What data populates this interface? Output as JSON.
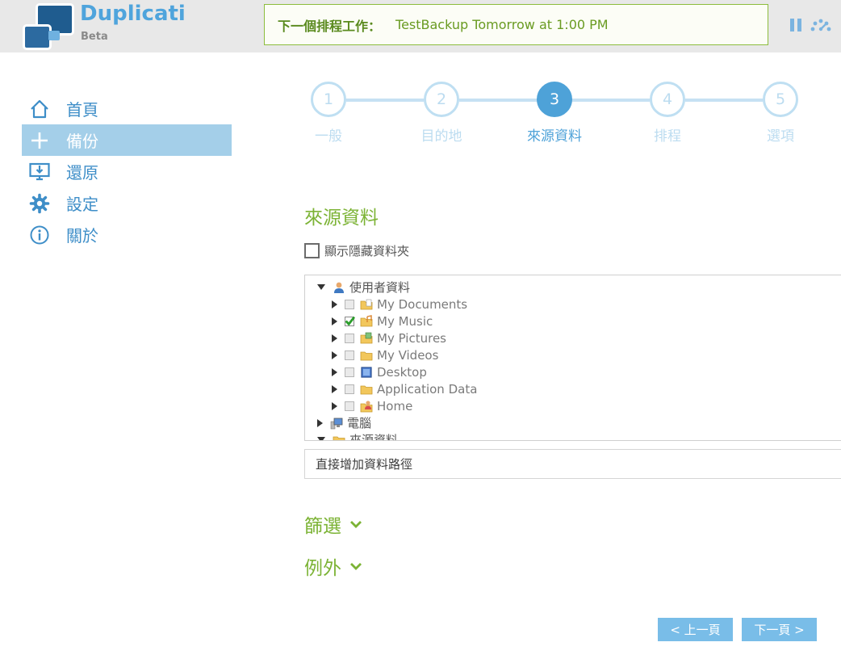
{
  "app": {
    "name": "Duplicati",
    "edition": "Beta"
  },
  "schedule": {
    "label": "下一個排程工作：",
    "value": "TestBackup Tomorrow at 1:00 PM"
  },
  "header_icons": [
    "pause-icon",
    "throttle-icon"
  ],
  "sidebar": {
    "items": [
      {
        "label": "首頁",
        "icon": "home-icon",
        "active": false
      },
      {
        "label": "備份",
        "icon": "plus-icon",
        "active": true
      },
      {
        "label": "還原",
        "icon": "restore-icon",
        "active": false
      },
      {
        "label": "設定",
        "icon": "gear-icon",
        "active": false
      },
      {
        "label": "關於",
        "icon": "info-icon",
        "active": false
      }
    ]
  },
  "stepper": {
    "current": 3,
    "steps": [
      {
        "number": "1",
        "label": "一般"
      },
      {
        "number": "2",
        "label": "目的地"
      },
      {
        "number": "3",
        "label": "來源資料"
      },
      {
        "number": "4",
        "label": "排程"
      },
      {
        "number": "5",
        "label": "選項"
      }
    ]
  },
  "source": {
    "title": "來源資料",
    "show_hidden_label": "顯示隱藏資料夾",
    "show_hidden_checked": false
  },
  "tree": {
    "nodes": [
      {
        "label": "使用者資料",
        "level": 0,
        "expanded": true,
        "checkbox": false,
        "icon": "user-icon"
      },
      {
        "label": "My Documents",
        "level": 1,
        "expanded": false,
        "checkbox": true,
        "checked": false,
        "icon": "documents-folder-icon"
      },
      {
        "label": "My Music",
        "level": 1,
        "expanded": false,
        "checkbox": true,
        "checked": true,
        "icon": "music-folder-icon"
      },
      {
        "label": "My Pictures",
        "level": 1,
        "expanded": false,
        "checkbox": true,
        "checked": false,
        "icon": "pictures-folder-icon"
      },
      {
        "label": "My Videos",
        "level": 1,
        "expanded": false,
        "checkbox": true,
        "checked": false,
        "icon": "folder-icon"
      },
      {
        "label": "Desktop",
        "level": 1,
        "expanded": false,
        "checkbox": true,
        "checked": false,
        "icon": "desktop-icon"
      },
      {
        "label": "Application Data",
        "level": 1,
        "expanded": false,
        "checkbox": true,
        "checked": false,
        "icon": "folder-icon"
      },
      {
        "label": "Home",
        "level": 1,
        "expanded": false,
        "checkbox": true,
        "checked": false,
        "icon": "home-folder-icon"
      },
      {
        "label": "電腦",
        "level": 0,
        "expanded": false,
        "checkbox": false,
        "icon": "computer-icon"
      },
      {
        "label": "來源資料",
        "level": 0,
        "expanded": true,
        "checkbox": false,
        "icon": "folder-icon"
      }
    ]
  },
  "path_input": {
    "placeholder": "直接增加資料路徑",
    "value": ""
  },
  "filters": {
    "label": "篩選"
  },
  "exceptions": {
    "label": "例外"
  },
  "buttons": {
    "previous": "< 上一頁",
    "next": "下一頁 >"
  },
  "colors": {
    "accent_blue": "#4ea2d8",
    "accent_green": "#7cb335",
    "active_nav": "#a4cfe9",
    "button": "#79bde8"
  }
}
